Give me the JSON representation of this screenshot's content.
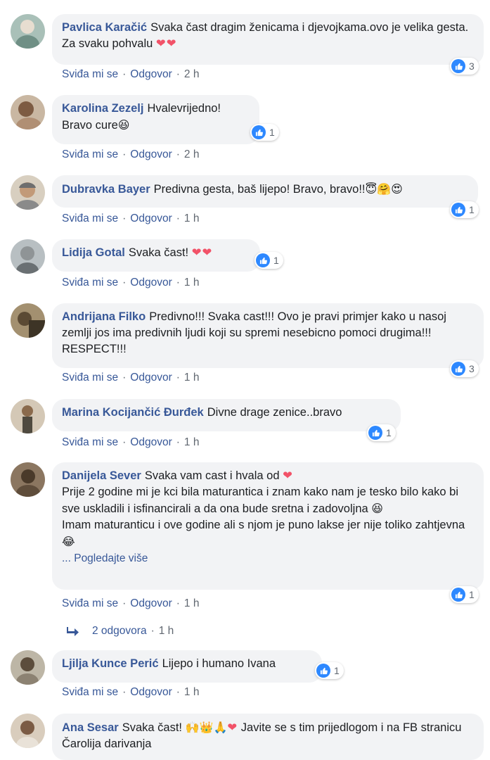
{
  "comments": [
    {
      "name": "Pavlica Karačić",
      "text": "Svaka čast dragim ženicama i djevojkama.ovo je velika gesta. Za svaku pohvalu",
      "hearts": "❤❤",
      "likes": "3",
      "like_action": "Sviđa mi se",
      "reply_action": "Odgovor",
      "time": "2 h",
      "avatar_color": "#8fa6a0"
    },
    {
      "name": "Karolina Zezelj",
      "text": "Hvalevrijedno!",
      "text2": "Bravo cure",
      "emoji": "😆",
      "likes": "1",
      "like_action": "Sviđa mi se",
      "reply_action": "Odgovor",
      "time": "2 h",
      "avatar_color": "#9a7a60"
    },
    {
      "name": "Dubravka Bayer",
      "text": "Predivna gesta, baš lijepo! Bravo, bravo!!",
      "emoji": "😇🤗😍",
      "likes": "1",
      "like_action": "Sviđa mi se",
      "reply_action": "Odgovor",
      "time": "1 h",
      "avatar_color": "#b5a790"
    },
    {
      "name": "Lidija Gotal",
      "text": "Svaka čast!",
      "hearts": "❤❤",
      "likes": "1",
      "like_action": "Sviđa mi se",
      "reply_action": "Odgovor",
      "time": "1 h",
      "avatar_color": "#a6adb0"
    },
    {
      "name": "Andrijana Filko",
      "text": "Predivno!!! Svaka cast!!! Ovo je pravi primjer kako u nasoj zemlji jos ima predivnih ljudi koji su spremi nesebicno pomoci drugima!!! RESPECT!!!",
      "likes": "3",
      "like_action": "Sviđa mi se",
      "reply_action": "Odgovor",
      "time": "1 h",
      "avatar_color": "#7c6a4a"
    },
    {
      "name": "Marina Kocijančić Đurđek",
      "text": "Divne drage zenice..bravo",
      "likes": "1",
      "like_action": "Sviđa mi se",
      "reply_action": "Odgovor",
      "time": "1 h",
      "avatar_color": "#c9b9a4"
    },
    {
      "name": "Danijela Sever",
      "text": "Svaka vam cast i hvala od",
      "hearts": "❤",
      "line2": "Prije 2 godine mi je kci bila maturantica i znam kako nam je tesko bilo kako bi sve uskladili i isfinancirali a da ona bude sretna i zadovoljna",
      "emoji2": "😆",
      "line3": "Imam maturanticu i ove godine ali s njom je puno lakse jer nije toliko zahtjevna",
      "emoji3": "😂",
      "see_more": "... Pogledajte više",
      "likes": "1",
      "like_action": "Sviđa mi se",
      "reply_action": "Odgovor",
      "time": "1 h",
      "avatar_color": "#6e5a44"
    },
    {
      "name": "Ljilja Kunce Perić",
      "text": "Lijepo i humano Ivana",
      "likes": "1",
      "like_action": "Sviđa mi se",
      "reply_action": "Odgovor",
      "time": "1 h",
      "avatar_color": "#8a8578"
    },
    {
      "name": "Ana Sesar",
      "text": "Svaka čast!",
      "emoji": "🙌👑🙏",
      "hearts": "❤",
      "text_after": "Javite se s tim prijedlogom i na FB stranicu Čarolija darivanja",
      "avatar_color": "#c8b8a6"
    }
  ],
  "replies": {
    "label": "2 odgovora",
    "time": "1 h"
  },
  "colors": {
    "link": "#385898",
    "bubble": "#f2f3f5",
    "like_blue": "#2d88ff",
    "heart": "#f25268"
  }
}
